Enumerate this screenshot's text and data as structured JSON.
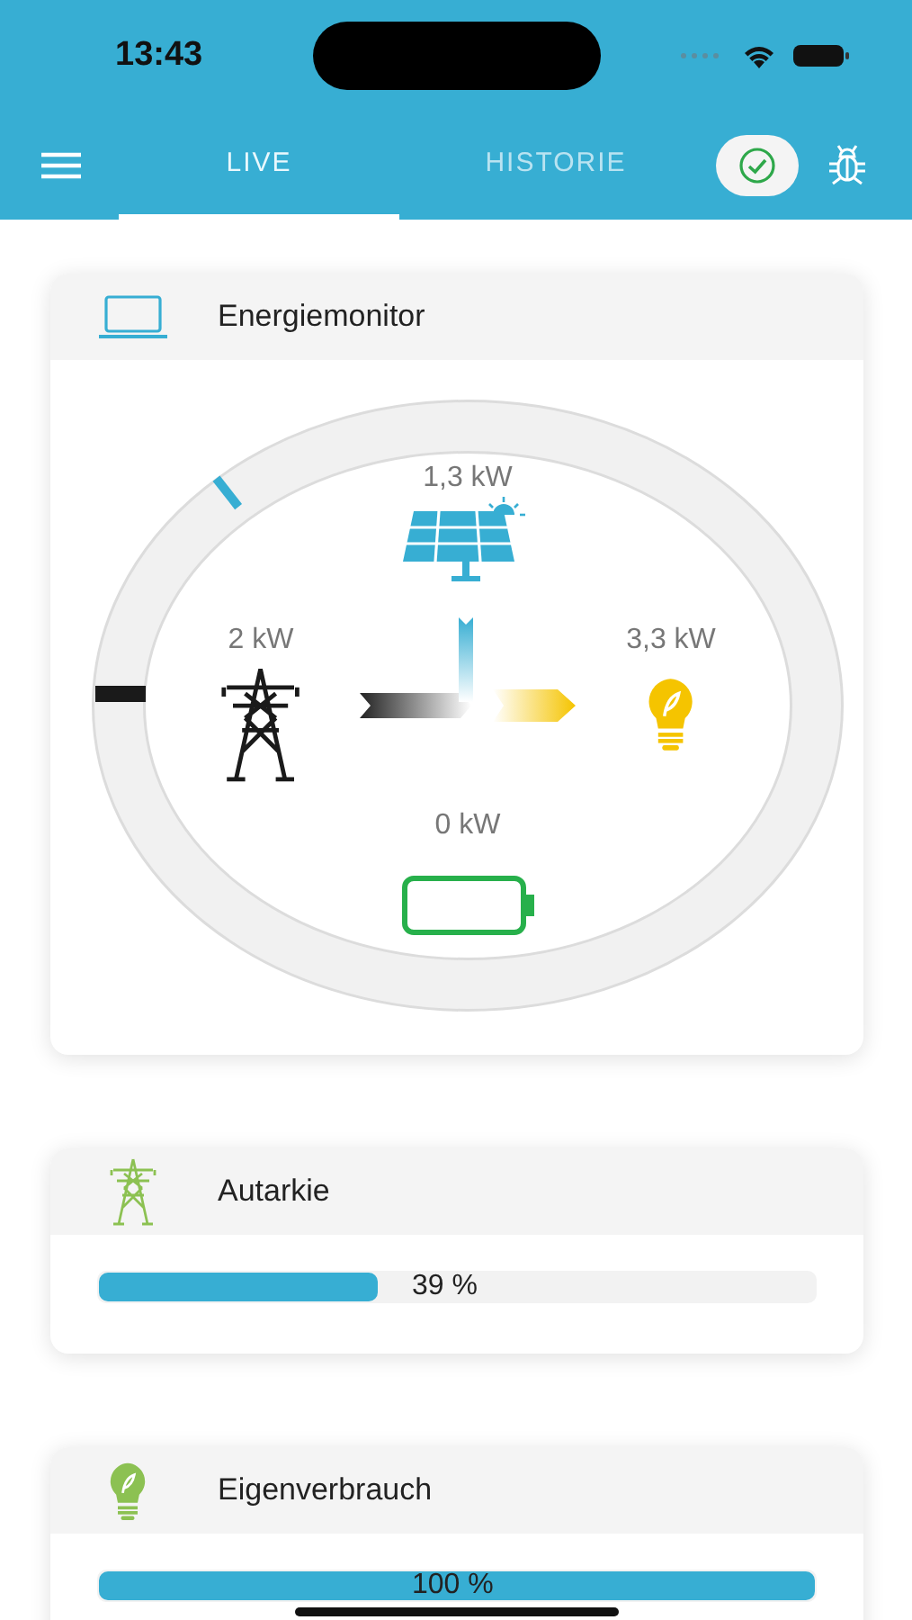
{
  "status_bar": {
    "time": "13:43"
  },
  "tabs": [
    {
      "label": "LIVE",
      "selected": true
    },
    {
      "label": "HISTORIE",
      "selected": false
    }
  ],
  "energy_monitor": {
    "title": "Energiemonitor",
    "nodes": [
      {
        "kind": "solar",
        "reading": "1,3 kW"
      },
      {
        "kind": "grid",
        "reading": "2 kW"
      },
      {
        "kind": "consumption",
        "reading": "3,3 kW"
      },
      {
        "kind": "battery",
        "reading": "0 kW"
      }
    ]
  },
  "stats": [
    {
      "kind": "grid",
      "title": "Autarkie",
      "level": 0.39,
      "reading": "39 %"
    },
    {
      "kind": "bulb",
      "title": "Eigenverbrauch",
      "level": 1.0,
      "reading": "100 %"
    }
  ]
}
